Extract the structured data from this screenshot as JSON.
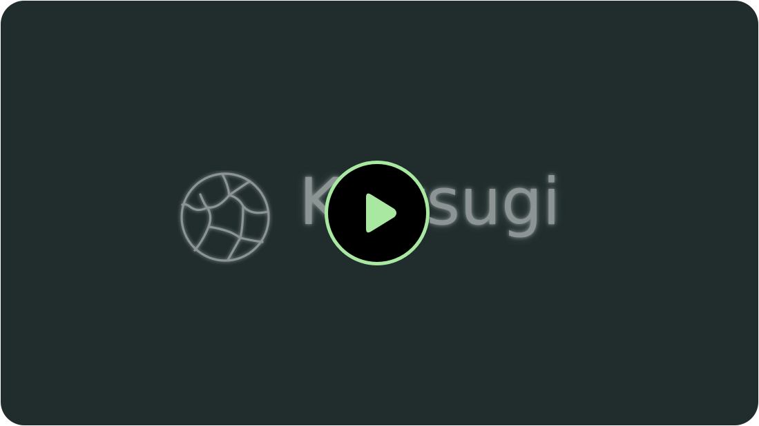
{
  "logo": {
    "wordmark": "Kintsugi",
    "icon": "cracked-globe-icon"
  },
  "player": {
    "play_icon": "play-icon",
    "colors": {
      "background": "#212d2d",
      "accent": "#a9e8a0",
      "button_fill": "#000000",
      "logo": "#8c9494"
    }
  }
}
